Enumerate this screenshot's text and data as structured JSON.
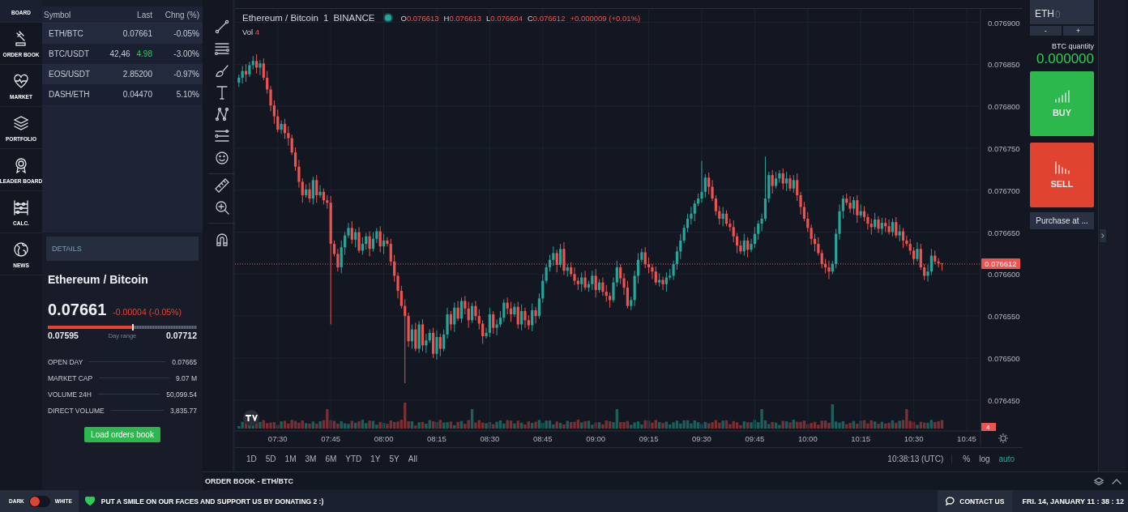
{
  "nav": {
    "items": [
      {
        "label": "BOARD",
        "kind": "board",
        "selected": true
      },
      {
        "label": "ORDER BOOK",
        "kind": "gavel",
        "selected": false
      },
      {
        "label": "MARKET",
        "kind": "heart",
        "selected": false
      },
      {
        "label": "PORTFOLIO",
        "kind": "layers",
        "selected": false
      },
      {
        "label": "LEADER BOARD",
        "kind": "medal",
        "selected": false
      },
      {
        "label": "CALC.",
        "kind": "abacus",
        "selected": false
      },
      {
        "label": "NEWS",
        "kind": "globe",
        "selected": false
      }
    ]
  },
  "markets": {
    "columns": [
      "Symbol",
      "Last",
      "Chng (%)"
    ],
    "rows": [
      {
        "symbol": "ETH/BTC",
        "last": "0.07661",
        "change": "-0.05%"
      },
      {
        "symbol": "BTC/USDT",
        "last": "42,46",
        "last_tick": "4.98",
        "change": "-3.00%"
      },
      {
        "symbol": "EOS/USDT",
        "last": "2.85200",
        "change": "-0.97%"
      },
      {
        "symbol": "DASH/ETH",
        "last": "0.04470",
        "change": "5.10%"
      }
    ]
  },
  "details": {
    "header": "DETAILS",
    "title": "Ethereum / Bitcoin",
    "price": "0.07661",
    "change": "-0.00004 (-0.05%)",
    "range": {
      "level": 0.565,
      "low": "0.07595",
      "label": "Day range",
      "high": "0.07712"
    },
    "stats": [
      {
        "label": "OPEN DAY",
        "value": "0.07665"
      },
      {
        "label": "MARKET CAP",
        "value": "9.07 M"
      },
      {
        "label": "VOLUME 24H",
        "value": "50,099.54"
      },
      {
        "label": "DIRECT VOLUME",
        "value": "3,835.77"
      }
    ],
    "button": "Load orders book"
  },
  "tool_groups": [
    {
      "tools": [
        {
          "kind": "trend-line"
        },
        {
          "kind": "lines"
        },
        {
          "kind": "brush"
        },
        {
          "kind": "text"
        },
        {
          "kind": "pattern"
        },
        {
          "kind": "fib"
        },
        {
          "kind": "smile"
        }
      ]
    },
    {
      "tools": [
        {
          "kind": "ruler"
        },
        {
          "kind": "zoom"
        }
      ]
    },
    {
      "tools": [
        {
          "kind": "magnet"
        }
      ]
    }
  ],
  "chart": {
    "symbol": "Ethereum / Bitcoin",
    "interval": "1",
    "exchange": "BINANCE",
    "ohlc": [
      {
        "label": "O",
        "value": "0.076613"
      },
      {
        "label": "H",
        "value": "0.076613"
      },
      {
        "label": "L",
        "value": "0.076604"
      },
      {
        "label": "C",
        "value": "0.076612"
      }
    ],
    "change": "+0.000009 (+0.01%)",
    "volume_label": "Vol",
    "volume": "4",
    "volume_tag": "4",
    "chart_data": {
      "type": "candlestick",
      "x": [
        439,
        440,
        441,
        442,
        443,
        444,
        445,
        446,
        447,
        448,
        449,
        450,
        451,
        452,
        453,
        454,
        455,
        456,
        457,
        458,
        459,
        460,
        461,
        462,
        463,
        464,
        465,
        466,
        467,
        468,
        469,
        470,
        471,
        472,
        473,
        474,
        475,
        476,
        477,
        478,
        479,
        480,
        481,
        482,
        483,
        484,
        485,
        486,
        487,
        488,
        489,
        490,
        491,
        492,
        493,
        494,
        495,
        496,
        497,
        498,
        499,
        500,
        501,
        502,
        503,
        504,
        505,
        506,
        507,
        508,
        509,
        510,
        511,
        512,
        513,
        514,
        515,
        516,
        517,
        518,
        519,
        520,
        521,
        522,
        523,
        524,
        525,
        526,
        527,
        528,
        529,
        530,
        531,
        532,
        533,
        534,
        535,
        536,
        537,
        538,
        539,
        540,
        541,
        542,
        543,
        544,
        545,
        546,
        547,
        548,
        549,
        550,
        551,
        552,
        553,
        554,
        555,
        556,
        557,
        558,
        559,
        560,
        561,
        562,
        563,
        564,
        565,
        566,
        567,
        568,
        569,
        570,
        571,
        572,
        573,
        574,
        575,
        576,
        577,
        578,
        579,
        580,
        581,
        582,
        583,
        584,
        585,
        586,
        587,
        588,
        589,
        590,
        591,
        592,
        593,
        594,
        595,
        596,
        597,
        598,
        599,
        600,
        601,
        602,
        603,
        604,
        605,
        606,
        607,
        608,
        609,
        610,
        611,
        612,
        613,
        614,
        615,
        616,
        617,
        618,
        619,
        620,
        621,
        622,
        623,
        624,
        625,
        626,
        627,
        628,
        629,
        630,
        631,
        632,
        633,
        634,
        635,
        636,
        637,
        638
      ],
      "ohlc": [
        [
          0.076828,
          0.076838,
          0.076823,
          0.076834
        ],
        [
          0.076834,
          0.076848,
          0.076827,
          0.076842
        ],
        [
          0.076842,
          0.07685,
          0.076829,
          0.076838
        ],
        [
          0.076838,
          0.076853,
          0.076835,
          0.076849
        ],
        [
          0.076849,
          0.07686,
          0.076844,
          0.076854
        ],
        [
          0.076854,
          0.076862,
          0.076839,
          0.076846
        ],
        [
          0.076846,
          0.076855,
          0.076837,
          0.076851
        ],
        [
          0.076851,
          0.076857,
          0.076831,
          0.076834
        ],
        [
          0.076834,
          0.076842,
          0.076815,
          0.07682
        ],
        [
          0.07682,
          0.076824,
          0.076794,
          0.076801
        ],
        [
          0.076801,
          0.076807,
          0.076779,
          0.076788
        ],
        [
          0.076788,
          0.076796,
          0.076769,
          0.076772
        ],
        [
          0.076772,
          0.076783,
          0.076767,
          0.076779
        ],
        [
          0.076779,
          0.076785,
          0.076761,
          0.076768
        ],
        [
          0.076768,
          0.076776,
          0.076753,
          0.076762
        ],
        [
          0.076762,
          0.076766,
          0.076742,
          0.076745
        ],
        [
          0.076745,
          0.076751,
          0.076723,
          0.076728
        ],
        [
          0.076728,
          0.076736,
          0.076703,
          0.07671
        ],
        [
          0.07671,
          0.076714,
          0.076685,
          0.076694
        ],
        [
          0.076694,
          0.076707,
          0.076691,
          0.076701
        ],
        [
          0.076701,
          0.076709,
          0.076685,
          0.07669
        ],
        [
          0.07669,
          0.076716,
          0.076683,
          0.076712
        ],
        [
          0.076712,
          0.076718,
          0.076685,
          0.076694
        ],
        [
          0.076694,
          0.076706,
          0.076691,
          0.076698
        ],
        [
          0.076698,
          0.076702,
          0.076683,
          0.076688
        ],
        [
          0.076688,
          0.076694,
          0.076678,
          0.076685
        ],
        [
          0.076685,
          0.076693,
          0.07654,
          0.076636
        ],
        [
          0.076636,
          0.07664,
          0.076621,
          0.076624
        ],
        [
          0.076624,
          0.07663,
          0.076603,
          0.076608
        ],
        [
          0.076608,
          0.07664,
          0.076601,
          0.076632
        ],
        [
          0.076632,
          0.07665,
          0.076623,
          0.076646
        ],
        [
          0.076646,
          0.076661,
          0.076643,
          0.076655
        ],
        [
          0.076655,
          0.076663,
          0.076636,
          0.076641
        ],
        [
          0.076641,
          0.076654,
          0.076632,
          0.07665
        ],
        [
          0.07665,
          0.076656,
          0.076625,
          0.076628
        ],
        [
          0.076628,
          0.076644,
          0.076623,
          0.076636
        ],
        [
          0.076636,
          0.076649,
          0.076629,
          0.076645
        ],
        [
          0.076645,
          0.076651,
          0.076621,
          0.07663
        ],
        [
          0.07663,
          0.07665,
          0.076627,
          0.076642
        ],
        [
          0.076642,
          0.076655,
          0.076637,
          0.076651
        ],
        [
          0.076651,
          0.076657,
          0.076626,
          0.076633
        ],
        [
          0.076633,
          0.076648,
          0.076624,
          0.07664
        ],
        [
          0.07664,
          0.076644,
          0.076633,
          0.076636
        ],
        [
          0.076636,
          0.076642,
          0.07661,
          0.076615
        ],
        [
          0.076615,
          0.076623,
          0.076591,
          0.076598
        ],
        [
          0.076598,
          0.076602,
          0.076571,
          0.07658
        ],
        [
          0.07658,
          0.076586,
          0.076559,
          0.076562
        ],
        [
          0.076562,
          0.07657,
          0.07647,
          0.07655
        ],
        [
          0.07655,
          0.076554,
          0.076513,
          0.07652
        ],
        [
          0.07652,
          0.07654,
          0.076511,
          0.076534
        ],
        [
          0.076534,
          0.076542,
          0.076508,
          0.076511
        ],
        [
          0.076511,
          0.076544,
          0.076506,
          0.07654
        ],
        [
          0.07654,
          0.076546,
          0.076508,
          0.076515
        ],
        [
          0.076515,
          0.076529,
          0.076506,
          0.076521
        ],
        [
          0.076521,
          0.076534,
          0.076518,
          0.07653
        ],
        [
          0.07653,
          0.076536,
          0.0765,
          0.076505
        ],
        [
          0.076505,
          0.076533,
          0.076498,
          0.076525
        ],
        [
          0.076525,
          0.076529,
          0.076502,
          0.076511
        ],
        [
          0.076511,
          0.076534,
          0.076508,
          0.076528
        ],
        [
          0.076528,
          0.07656,
          0.076523,
          0.076552
        ],
        [
          0.076552,
          0.076556,
          0.076533,
          0.07654
        ],
        [
          0.07654,
          0.076566,
          0.076531,
          0.07656
        ],
        [
          0.07656,
          0.076568,
          0.076544,
          0.076547
        ],
        [
          0.076547,
          0.076572,
          0.076542,
          0.076568
        ],
        [
          0.076568,
          0.076574,
          0.076552,
          0.076559
        ],
        [
          0.076559,
          0.076567,
          0.076536,
          0.076545
        ],
        [
          0.076545,
          0.076566,
          0.076542,
          0.076562
        ],
        [
          0.076562,
          0.076568,
          0.076545,
          0.07655
        ],
        [
          0.07655,
          0.076558,
          0.076534,
          0.076541
        ],
        [
          0.076541,
          0.076545,
          0.076517,
          0.076526
        ],
        [
          0.076526,
          0.076536,
          0.076523,
          0.07653
        ],
        [
          0.07653,
          0.07656,
          0.076525,
          0.076552
        ],
        [
          0.076552,
          0.076556,
          0.076529,
          0.076536
        ],
        [
          0.076536,
          0.076546,
          0.076527,
          0.07654
        ],
        [
          0.07654,
          0.076556,
          0.076537,
          0.076548
        ],
        [
          0.076548,
          0.07657,
          0.076543,
          0.076566
        ],
        [
          0.076566,
          0.076572,
          0.076552,
          0.076559
        ],
        [
          0.076559,
          0.076567,
          0.076543,
          0.076552
        ],
        [
          0.076552,
          0.076565,
          0.076549,
          0.076561
        ],
        [
          0.076561,
          0.076567,
          0.076535,
          0.07654
        ],
        [
          0.07654,
          0.076564,
          0.076533,
          0.076556
        ],
        [
          0.076556,
          0.07656,
          0.076536,
          0.076545
        ],
        [
          0.076545,
          0.076551,
          0.076534,
          0.076539
        ],
        [
          0.076539,
          0.076565,
          0.076532,
          0.076557
        ],
        [
          0.076557,
          0.076561,
          0.076541,
          0.07655
        ],
        [
          0.07655,
          0.076577,
          0.076547,
          0.076571
        ],
        [
          0.076571,
          0.0766,
          0.076566,
          0.076592
        ],
        [
          0.076592,
          0.076612,
          0.076589,
          0.076608
        ],
        [
          0.076608,
          0.076623,
          0.076603,
          0.076617
        ],
        [
          0.076617,
          0.076633,
          0.07661,
          0.076625
        ],
        [
          0.076625,
          0.076629,
          0.076602,
          0.076611
        ],
        [
          0.076611,
          0.076636,
          0.076608,
          0.07663
        ],
        [
          0.07663,
          0.076638,
          0.076599,
          0.076604
        ],
        [
          0.076604,
          0.076612,
          0.076597,
          0.076608
        ],
        [
          0.076608,
          0.076614,
          0.076597,
          0.0766
        ],
        [
          0.0766,
          0.076608,
          0.076587,
          0.076592
        ],
        [
          0.076592,
          0.076596,
          0.076581,
          0.076588
        ],
        [
          0.076588,
          0.076602,
          0.076579,
          0.076596
        ],
        [
          0.076596,
          0.076604,
          0.076581,
          0.076584
        ],
        [
          0.076584,
          0.076592,
          0.076579,
          0.076588
        ],
        [
          0.076588,
          0.076604,
          0.076581,
          0.076598
        ],
        [
          0.076598,
          0.076606,
          0.076572,
          0.076581
        ],
        [
          0.076581,
          0.076594,
          0.076578,
          0.07659
        ],
        [
          0.07659,
          0.076596,
          0.076574,
          0.076579
        ],
        [
          0.076579,
          0.076587,
          0.076567,
          0.076574
        ],
        [
          0.076574,
          0.076578,
          0.07656,
          0.076569
        ],
        [
          0.076569,
          0.076596,
          0.076566,
          0.07659
        ],
        [
          0.07659,
          0.076616,
          0.076585,
          0.076608
        ],
        [
          0.076608,
          0.076612,
          0.076588,
          0.076595
        ],
        [
          0.076595,
          0.076601,
          0.076575,
          0.076584
        ],
        [
          0.076584,
          0.076592,
          0.076559,
          0.076562
        ],
        [
          0.076562,
          0.076573,
          0.076557,
          0.076569
        ],
        [
          0.076569,
          0.076604,
          0.076562,
          0.076598
        ],
        [
          0.076598,
          0.076625,
          0.076589,
          0.076617
        ],
        [
          0.076617,
          0.07663,
          0.076614,
          0.076626
        ],
        [
          0.076626,
          0.076632,
          0.076607,
          0.076612
        ],
        [
          0.076612,
          0.07662,
          0.076601,
          0.076608
        ],
        [
          0.076608,
          0.076612,
          0.076594,
          0.076603
        ],
        [
          0.076603,
          0.076609,
          0.076587,
          0.07659
        ],
        [
          0.07659,
          0.076601,
          0.076585,
          0.076593
        ],
        [
          0.076593,
          0.076597,
          0.076581,
          0.076588
        ],
        [
          0.076588,
          0.076602,
          0.076579,
          0.076596
        ],
        [
          0.076596,
          0.076606,
          0.076593,
          0.076598
        ],
        [
          0.076598,
          0.076616,
          0.076593,
          0.076612
        ],
        [
          0.076612,
          0.076633,
          0.076605,
          0.076627
        ],
        [
          0.076627,
          0.076648,
          0.076618,
          0.07664
        ],
        [
          0.07664,
          0.076659,
          0.076637,
          0.076655
        ],
        [
          0.076655,
          0.076672,
          0.07665,
          0.076666
        ],
        [
          0.076666,
          0.07668,
          0.076659,
          0.076672
        ],
        [
          0.076672,
          0.076688,
          0.076663,
          0.076684
        ],
        [
          0.076684,
          0.076696,
          0.076681,
          0.07669
        ],
        [
          0.07669,
          0.076735,
          0.076685,
          0.076698
        ],
        [
          0.076698,
          0.076719,
          0.076691,
          0.076715
        ],
        [
          0.076715,
          0.076721,
          0.076695,
          0.076704
        ],
        [
          0.076704,
          0.076712,
          0.076687,
          0.07669
        ],
        [
          0.07669,
          0.076694,
          0.07667,
          0.076675
        ],
        [
          0.076675,
          0.076681,
          0.076659,
          0.076666
        ],
        [
          0.076666,
          0.07668,
          0.076657,
          0.076672
        ],
        [
          0.076672,
          0.076676,
          0.076657,
          0.07666
        ],
        [
          0.07666,
          0.076666,
          0.076651,
          0.076656
        ],
        [
          0.076656,
          0.076664,
          0.076638,
          0.076645
        ],
        [
          0.076645,
          0.076649,
          0.076625,
          0.076634
        ],
        [
          0.076634,
          0.07664,
          0.076624,
          0.076627
        ],
        [
          0.076627,
          0.076648,
          0.076622,
          0.07664
        ],
        [
          0.07664,
          0.076644,
          0.07662,
          0.076629
        ],
        [
          0.076629,
          0.076642,
          0.076626,
          0.076636
        ],
        [
          0.076636,
          0.076656,
          0.076631,
          0.076648
        ],
        [
          0.076648,
          0.076664,
          0.076641,
          0.07666
        ],
        [
          0.07666,
          0.076672,
          0.076651,
          0.076666
        ],
        [
          0.076666,
          0.07674,
          0.076663,
          0.07669
        ],
        [
          0.07669,
          0.076722,
          0.076685,
          0.076718
        ],
        [
          0.076718,
          0.076724,
          0.076696,
          0.076705
        ],
        [
          0.076705,
          0.076722,
          0.076702,
          0.076714
        ],
        [
          0.076714,
          0.076724,
          0.076709,
          0.07672
        ],
        [
          0.07672,
          0.076726,
          0.076701,
          0.076708
        ],
        [
          0.076708,
          0.076722,
          0.076699,
          0.076714
        ],
        [
          0.076714,
          0.076718,
          0.076699,
          0.076702
        ],
        [
          0.076702,
          0.076718,
          0.076697,
          0.076712
        ],
        [
          0.076712,
          0.07672,
          0.076687,
          0.076694
        ],
        [
          0.076694,
          0.076698,
          0.076671,
          0.07668
        ],
        [
          0.07668,
          0.076686,
          0.076663,
          0.076666
        ],
        [
          0.076666,
          0.076674,
          0.07665,
          0.076655
        ],
        [
          0.076655,
          0.076659,
          0.076635,
          0.076642
        ],
        [
          0.076642,
          0.076648,
          0.076627,
          0.076636
        ],
        [
          0.076636,
          0.076644,
          0.076622,
          0.076625
        ],
        [
          0.076625,
          0.076629,
          0.076607,
          0.076612
        ],
        [
          0.076612,
          0.076618,
          0.076601,
          0.076608
        ],
        [
          0.076608,
          0.076616,
          0.076594,
          0.076603
        ],
        [
          0.076603,
          0.076616,
          0.0766,
          0.076612
        ],
        [
          0.076612,
          0.076654,
          0.076607,
          0.076648
        ],
        [
          0.076648,
          0.076683,
          0.076641,
          0.076675
        ],
        [
          0.076675,
          0.076694,
          0.076666,
          0.07669
        ],
        [
          0.07669,
          0.076696,
          0.076682,
          0.076685
        ],
        [
          0.076685,
          0.076693,
          0.076673,
          0.076678
        ],
        [
          0.076678,
          0.076692,
          0.076671,
          0.076688
        ],
        [
          0.076688,
          0.076694,
          0.076661,
          0.07667
        ],
        [
          0.07667,
          0.076683,
          0.076667,
          0.076675
        ],
        [
          0.076675,
          0.076681,
          0.076663,
          0.076668
        ],
        [
          0.076668,
          0.076672,
          0.076653,
          0.07666
        ],
        [
          0.07666,
          0.076666,
          0.076647,
          0.076656
        ],
        [
          0.076656,
          0.076673,
          0.076653,
          0.076665
        ],
        [
          0.076665,
          0.076669,
          0.076649,
          0.076654
        ],
        [
          0.076654,
          0.076667,
          0.076647,
          0.076661
        ],
        [
          0.076661,
          0.076667,
          0.07665,
          0.076657
        ],
        [
          0.076657,
          0.076665,
          0.076647,
          0.07665
        ],
        [
          0.07665,
          0.076666,
          0.076645,
          0.076662
        ],
        [
          0.076662,
          0.076668,
          0.076643,
          0.076646
        ],
        [
          0.076646,
          0.076659,
          0.076639,
          0.076651
        ],
        [
          0.076651,
          0.076655,
          0.076631,
          0.07664
        ],
        [
          0.07664,
          0.076646,
          0.076633,
          0.076636
        ],
        [
          0.076636,
          0.076642,
          0.076623,
          0.076628
        ],
        [
          0.076628,
          0.076632,
          0.076611,
          0.076618
        ],
        [
          0.076618,
          0.076638,
          0.076615,
          0.07663
        ],
        [
          0.07663,
          0.076636,
          0.076605,
          0.076608
        ],
        [
          0.076608,
          0.076612,
          0.076593,
          0.076598
        ],
        [
          0.076598,
          0.076611,
          0.076591,
          0.076603
        ],
        [
          0.076603,
          0.07663,
          0.076599,
          0.076622
        ],
        [
          0.076622,
          0.076628,
          0.076612,
          0.076615
        ],
        [
          0.076615,
          0.076619,
          0.076608,
          0.076613
        ],
        [
          0.076613,
          0.076613,
          0.076604,
          0.076612
        ]
      ],
      "xticks": [
        {
          "value": 450,
          "label": "07:30"
        },
        {
          "value": 465,
          "label": "07:45"
        },
        {
          "value": 480,
          "label": "08:00"
        },
        {
          "value": 495,
          "label": "08:15"
        },
        {
          "value": 510,
          "label": "08:30"
        },
        {
          "value": 525,
          "label": "08:45"
        },
        {
          "value": 540,
          "label": "09:00"
        },
        {
          "value": 555,
          "label": "09:15"
        },
        {
          "value": 570,
          "label": "09:30"
        },
        {
          "value": 585,
          "label": "09:45"
        },
        {
          "value": 600,
          "label": "10:00"
        },
        {
          "value": 615,
          "label": "10:15"
        },
        {
          "value": 630,
          "label": "10:30"
        },
        {
          "value": 645,
          "label": "10:45"
        }
      ],
      "yticks": [
        {
          "value": 0.0769,
          "label": "0.076900"
        },
        {
          "value": 0.07685,
          "label": "0.076850"
        },
        {
          "value": 0.0768,
          "label": "0.076800"
        },
        {
          "value": 0.07675,
          "label": "0.076750"
        },
        {
          "value": 0.0767,
          "label": "0.076700"
        },
        {
          "value": 0.07665,
          "label": "0.076650"
        },
        {
          "value": 0.0766,
          "label": "0.076600"
        },
        {
          "value": 0.07655,
          "label": "0.076550"
        },
        {
          "value": 0.0765,
          "label": "0.076500"
        },
        {
          "value": 0.07645,
          "label": "0.076450"
        }
      ],
      "xlim": [
        437.9,
        648.9
      ],
      "ylim": [
        0.076414,
        0.076916
      ],
      "grid": true
    },
    "last_price": "0.076612",
    "ranges": [
      "1D",
      "5D",
      "1M",
      "3M",
      "6M",
      "YTD",
      "1Y",
      "5Y",
      "All"
    ],
    "clock": "10:38:13 (UTC)",
    "scale_options": [
      {
        "label": "%",
        "selected": false
      },
      {
        "label": "log",
        "selected": false
      },
      {
        "label": "auto",
        "selected": true
      }
    ]
  },
  "trade": {
    "unit": "ETH",
    "placeholder": "0",
    "steppers": [
      "-",
      "+"
    ],
    "quantity_label": "BTC quantity",
    "quantity": "0.000000",
    "buy": "BUY",
    "sell": "SELL",
    "purchase": "Purchase at ..."
  },
  "order_book": {
    "title": "ORDER BOOK - ETH/BTC"
  },
  "footer": {
    "theme": {
      "dark_label": "DARK",
      "light_label": "WHITE",
      "dark": true
    },
    "donation": "PUT A SMILE ON OUR FACES AND SUPPORT US BY DONATING 2 :)",
    "contact": "CONTACT US",
    "datetime": "FRI. 14, JANUARY 11 : 38 : 12"
  }
}
